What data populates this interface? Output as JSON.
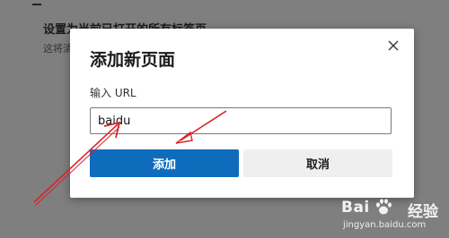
{
  "background": {
    "heading": "设置为当前已打开的所有标签页",
    "subtext": "这将清"
  },
  "dialog": {
    "title": "添加新页面",
    "close_icon": "close-icon",
    "url_label": "输入 URL",
    "url_value": "baidu",
    "add_label": "添加",
    "cancel_label": "取消"
  },
  "watermark": {
    "brand": "Bai",
    "paw_icon": "paw-icon",
    "suffix": "经验",
    "url": "jingyan.baidu.com"
  },
  "colors": {
    "overlay": "#7f7f7f",
    "primary": "#0f6cbd",
    "secondary": "#efefef",
    "annotation": "#d9232a"
  }
}
